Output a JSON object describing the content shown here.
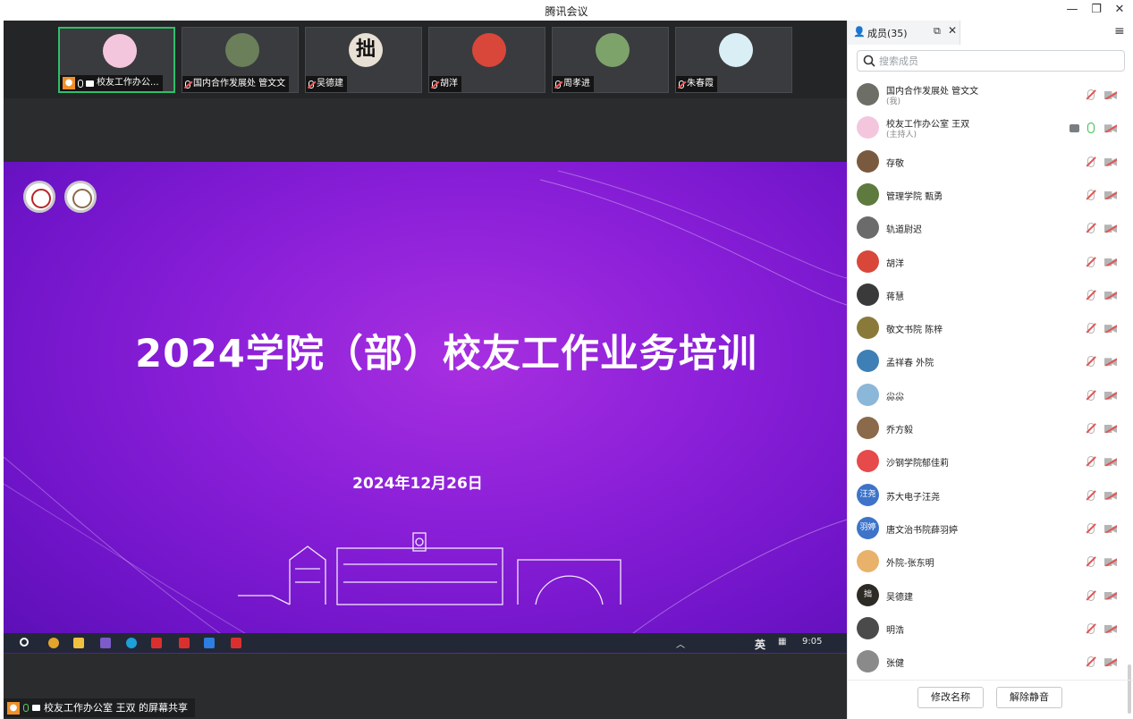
{
  "window": {
    "title": "腾讯会议",
    "minimize": "—",
    "restore": "❐",
    "close": "✕"
  },
  "thumbnails": [
    {
      "name": "校友工作办公...",
      "muted": false,
      "color": "#f4c6dd",
      "active": true,
      "sharing": true
    },
    {
      "name": "国内合作发展处 管文文",
      "muted": true,
      "color": "#6b7f5a",
      "active": false
    },
    {
      "name": "吴德建",
      "muted": true,
      "color": "#e8e0d4",
      "glyph": "拙",
      "active": false
    },
    {
      "name": "胡洋",
      "muted": true,
      "color": "#d9473a",
      "active": false
    },
    {
      "name": "周孝进",
      "muted": true,
      "color": "#7da36a",
      "active": false
    },
    {
      "name": "朱春霞",
      "muted": true,
      "color": "#d9eef5",
      "active": false
    }
  ],
  "slide": {
    "title": "2024学院（部）校友工作业务培训",
    "date": "2024年12月26日"
  },
  "taskbar": {
    "ime": "英",
    "time": "9:05"
  },
  "share_status": "校友工作办公室 王双 的屏幕共享",
  "panel": {
    "tab_label": "成员(35)",
    "search_placeholder": "搜索成员",
    "members": [
      {
        "name": "国内合作发展处 管文文",
        "sub": "(我)",
        "color": "#6d6f67",
        "mic": "muted"
      },
      {
        "name": "校友工作办公室 王双",
        "sub": "(主持人)",
        "color": "#f4c6dd",
        "mic": "on",
        "sharing": true
      },
      {
        "name": "存敬",
        "sub": "",
        "color": "#7a5a3e",
        "mic": "muted"
      },
      {
        "name": "管理学院 甄勇",
        "sub": "",
        "color": "#5e7a3f",
        "mic": "muted"
      },
      {
        "name": "轨道尉迟",
        "sub": "",
        "color": "#6b6b6b",
        "mic": "muted"
      },
      {
        "name": "胡洋",
        "sub": "",
        "color": "#d9473a",
        "mic": "muted"
      },
      {
        "name": "蒋慧",
        "sub": "",
        "color": "#3a3a3a",
        "mic": "muted"
      },
      {
        "name": "敬文书院 陈梓",
        "sub": "",
        "color": "#8a7a3a",
        "mic": "muted"
      },
      {
        "name": "孟祥春 外院",
        "sub": "",
        "color": "#3e7fb5",
        "mic": "muted"
      },
      {
        "name": "尛尛",
        "sub": "",
        "color": "#8bb7d8",
        "mic": "muted"
      },
      {
        "name": "乔方毅",
        "sub": "",
        "color": "#8a6a4a",
        "mic": "muted"
      },
      {
        "name": "沙钢学院郁佳莉",
        "sub": "",
        "color": "#e64a4a",
        "mic": "muted"
      },
      {
        "name": "苏大电子汪尧",
        "sub": "",
        "avatar_text": "汪尧",
        "color": "#3d74c9",
        "mic": "muted"
      },
      {
        "name": "唐文治书院薛羽婷",
        "sub": "",
        "avatar_text": "羽婷",
        "color": "#3d74c9",
        "mic": "muted"
      },
      {
        "name": "外院-张东明",
        "sub": "",
        "color": "#e8b26a",
        "mic": "muted"
      },
      {
        "name": "吴德建",
        "sub": "",
        "avatar_text": "拙",
        "color": "#2e2a26",
        "mic": "muted"
      },
      {
        "name": "明浩",
        "sub": "",
        "color": "#4a4a4a",
        "mic": "muted"
      },
      {
        "name": "张健",
        "sub": "",
        "color": "#8a8a8a",
        "mic": "muted"
      }
    ],
    "footer": {
      "rename": "修改名称",
      "unmute": "解除静音"
    }
  }
}
